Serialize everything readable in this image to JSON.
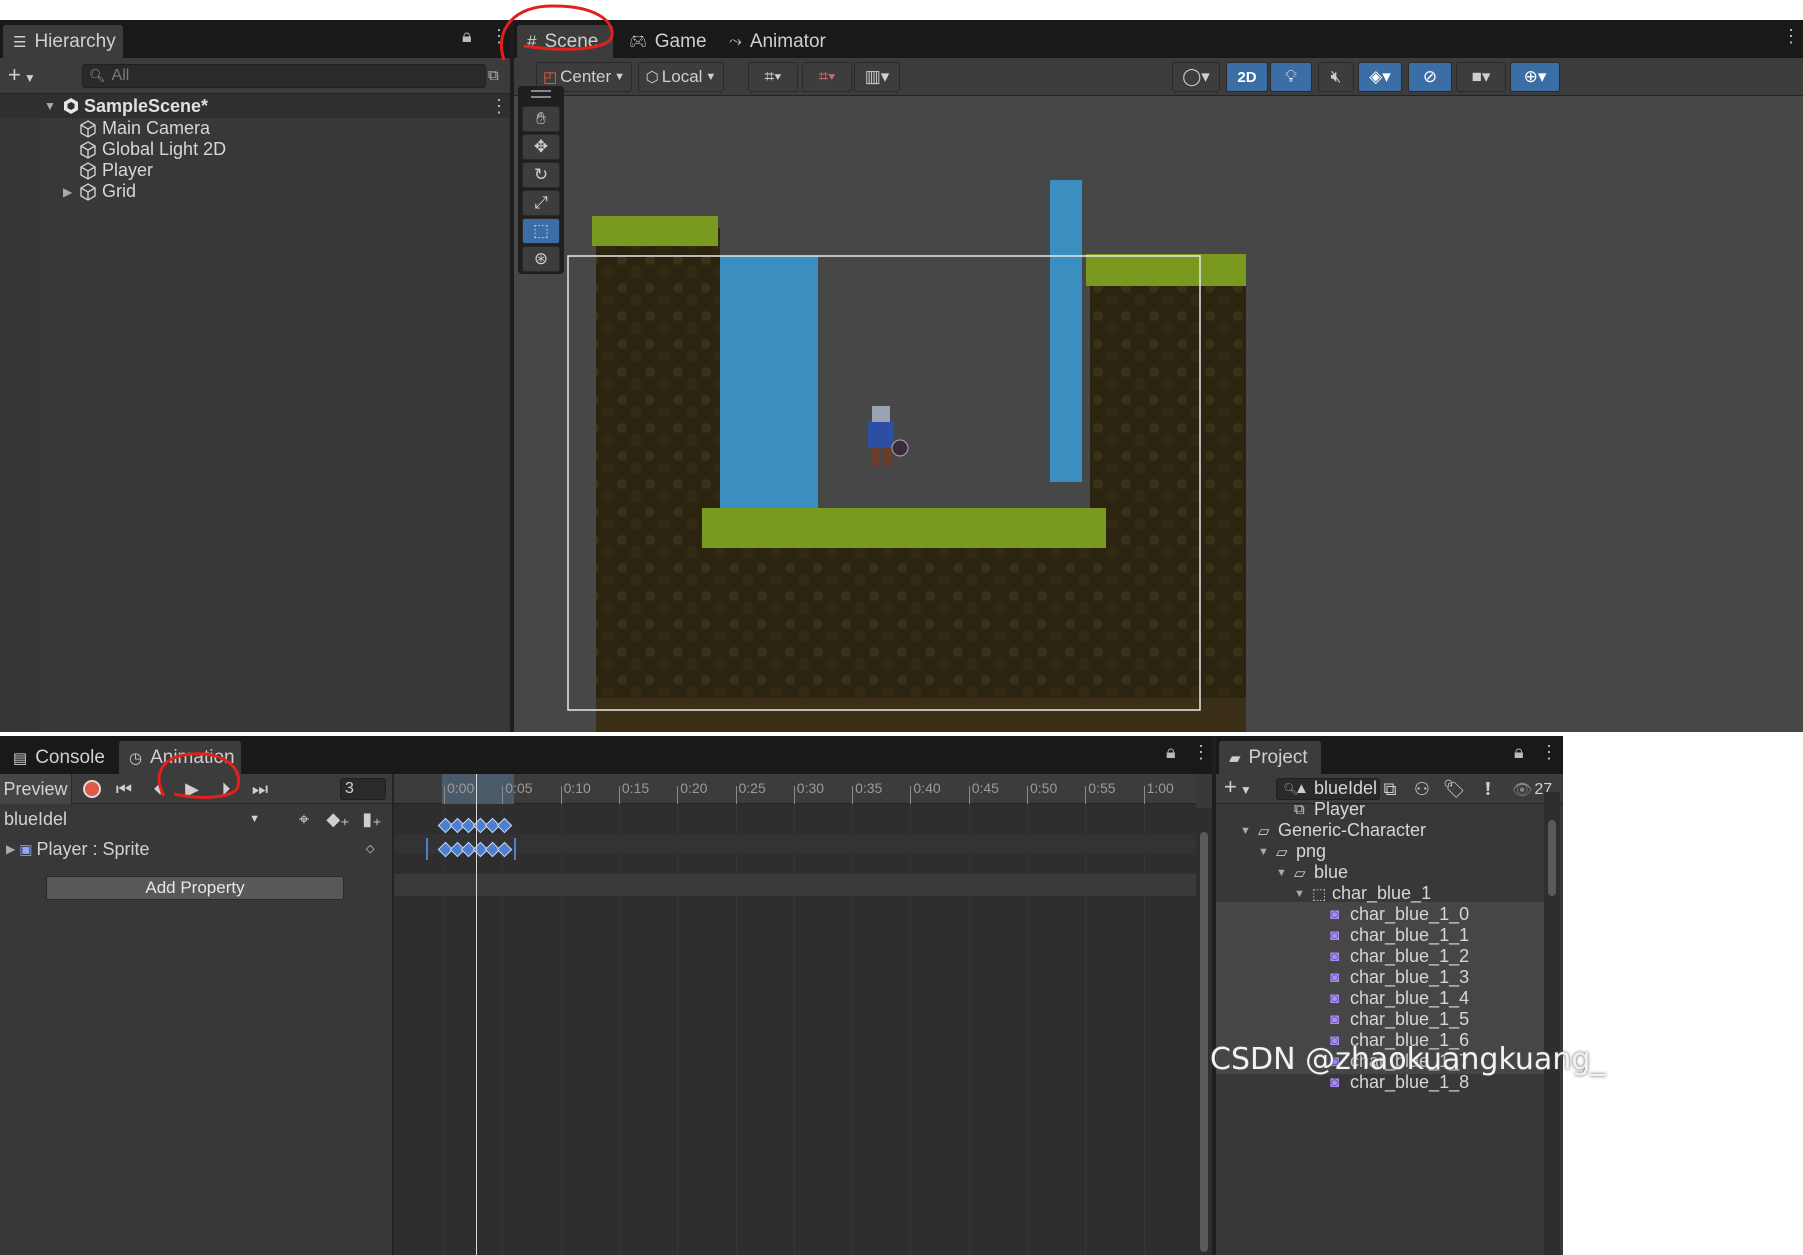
{
  "hierarchy": {
    "tab_label": "Hierarchy",
    "search_placeholder": "All",
    "scene_name": "SampleScene*",
    "items": [
      "Main Camera",
      "Global Light 2D",
      "Player",
      "Grid"
    ]
  },
  "scene_view": {
    "tabs": [
      "Scene",
      "Game",
      "Animator"
    ],
    "pivot_label": "Center",
    "space_label": "Local",
    "toggle_2d_label": "2D"
  },
  "bottom_tabs": [
    "Console",
    "Animation"
  ],
  "animation": {
    "preview_label": "Preview",
    "frame_value": "3",
    "clip_name": "blueIdel",
    "property_label": "Player : Sprite",
    "add_property_label": "Add Property",
    "ruler_ticks": [
      "0:00",
      "0:05",
      "0:10",
      "0:15",
      "0:20",
      "0:25",
      "0:30",
      "0:35",
      "0:40",
      "0:45",
      "0:50",
      "0:55",
      "1:00"
    ]
  },
  "project": {
    "tab_label": "Project",
    "hidden_count": "27",
    "items": [
      {
        "label": "blueIdel",
        "indent": 2,
        "kind": "anim"
      },
      {
        "label": "Player",
        "indent": 2,
        "kind": "controller"
      },
      {
        "label": "Generic-Character",
        "indent": 0,
        "kind": "folder",
        "expanded": true
      },
      {
        "label": "png",
        "indent": 1,
        "kind": "folder",
        "expanded": true
      },
      {
        "label": "blue",
        "indent": 2,
        "kind": "folder",
        "expanded": true
      },
      {
        "label": "char_blue_1",
        "indent": 3,
        "kind": "texture",
        "expanded": true
      },
      {
        "label": "char_blue_1_0",
        "indent": 4,
        "kind": "sprite"
      },
      {
        "label": "char_blue_1_1",
        "indent": 4,
        "kind": "sprite"
      },
      {
        "label": "char_blue_1_2",
        "indent": 4,
        "kind": "sprite"
      },
      {
        "label": "char_blue_1_3",
        "indent": 4,
        "kind": "sprite"
      },
      {
        "label": "char_blue_1_4",
        "indent": 4,
        "kind": "sprite"
      },
      {
        "label": "char_blue_1_5",
        "indent": 4,
        "kind": "sprite"
      },
      {
        "label": "char_blue_1_6",
        "indent": 4,
        "kind": "sprite"
      },
      {
        "label": "char_blue_1_7",
        "indent": 4,
        "kind": "sprite"
      },
      {
        "label": "char_blue_1_8",
        "indent": 4,
        "kind": "sprite"
      }
    ]
  },
  "watermark": "CSDN @zhaokuangkuang_",
  "colors": {
    "accent_blue": "#3a6ea5",
    "keyframe": "#4d7fcf",
    "annotation": "#e3211c",
    "grass": "#7a9a1f",
    "water": "#3a8fc0",
    "dirt": "#2a2412"
  }
}
